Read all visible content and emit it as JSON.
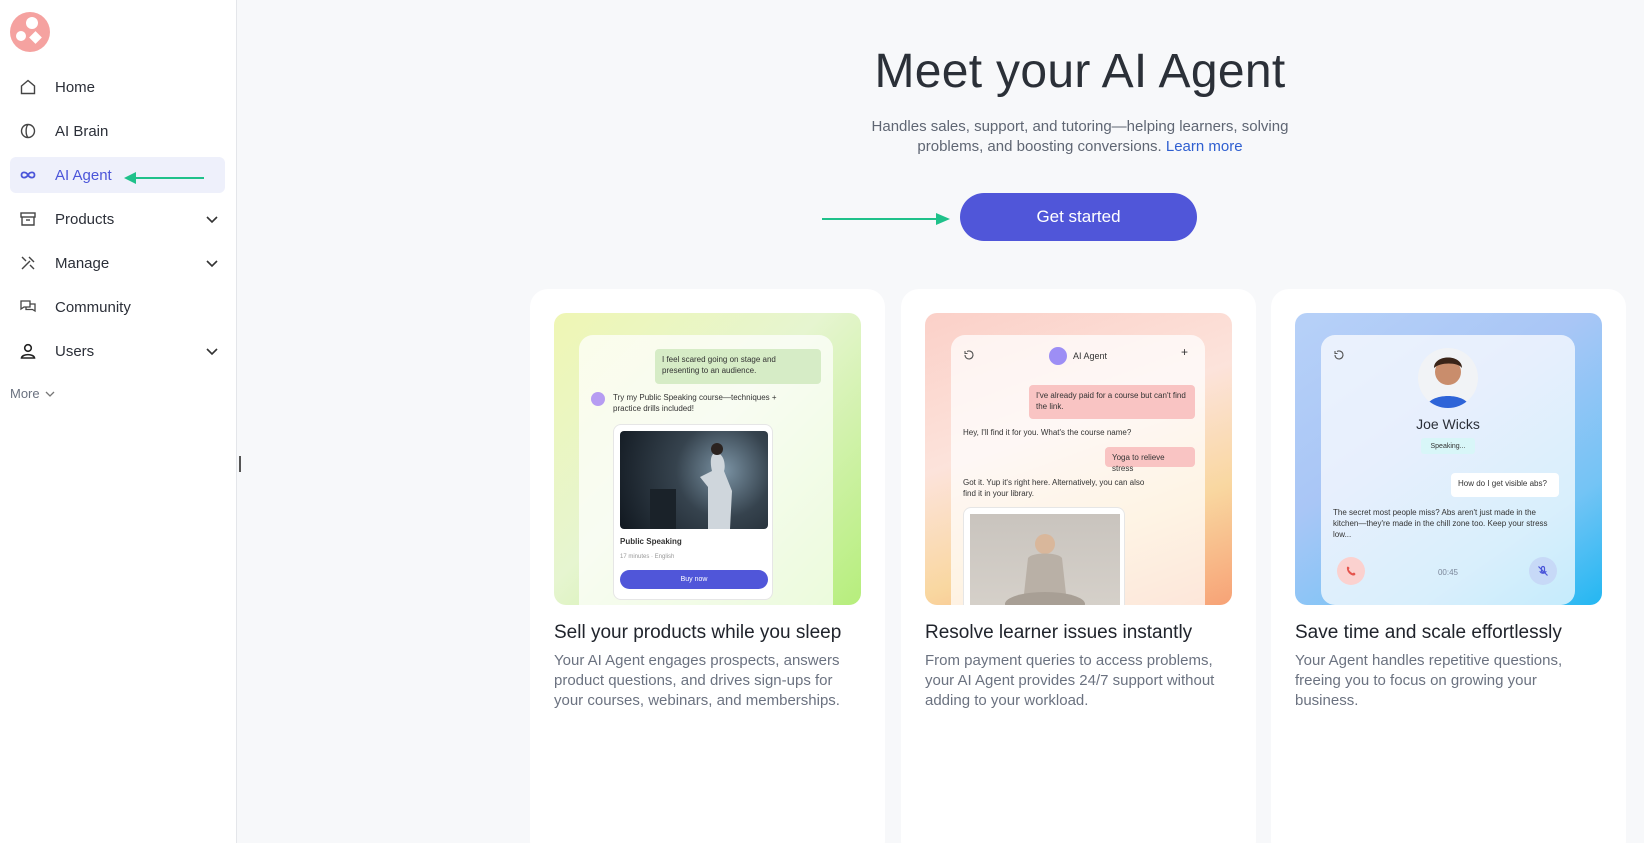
{
  "sidebar": {
    "nav": [
      {
        "label": "Home",
        "icon": "home-icon"
      },
      {
        "label": "AI Brain",
        "icon": "brain-icon"
      },
      {
        "label": "AI Agent",
        "icon": "infinity-icon",
        "active": true
      },
      {
        "label": "Products",
        "icon": "archive-icon",
        "expandable": true
      },
      {
        "label": "Manage",
        "icon": "tools-icon",
        "expandable": true
      },
      {
        "label": "Community",
        "icon": "chat-icon"
      },
      {
        "label": "Users",
        "icon": "user-icon",
        "expandable": true
      }
    ],
    "more_label": "More"
  },
  "hero": {
    "title": "Meet your AI Agent",
    "subtitle_line": "Handles sales, support, and tutoring—helping learners, solving problems, and boosting conversions.",
    "learn_more": "Learn more",
    "cta_label": "Get started"
  },
  "cards": [
    {
      "title": "Sell your products while you sleep",
      "desc": "Your AI Agent engages prospects, answers product questions, and drives sign-ups for your courses, webinars, and memberships.",
      "mock": {
        "user_msg": "I feel scared going on stage and presenting to an audience.",
        "agent_msg": "Try my Public Speaking course—techniques + practice drills included!",
        "product_name": "Public Speaking",
        "product_meta": "17 minutes · English",
        "buy_label": "Buy now"
      }
    },
    {
      "title": "Resolve learner issues instantly",
      "desc": "From payment queries to access problems, your AI Agent provides 24/7 support without adding to your workload.",
      "mock": {
        "header": "AI Agent",
        "user_msg1": "I've already paid for a course but can't find the link.",
        "agent_msg1": "Hey, I'll find it for you. What's the course name?",
        "user_msg2": "Yoga to relieve stress",
        "agent_msg2": "Got it. Yup it's right here. Alternatively, you can also find it in your library."
      }
    },
    {
      "title": "Save time and scale effortlessly",
      "desc": "Your Agent handles repetitive questions, freeing you to focus on growing your business.",
      "mock": {
        "name": "Joe Wicks",
        "status": "Speaking...",
        "user_msg": "How do I get visible abs?",
        "agent_msg": "The secret most people miss? Abs aren't just made in the kitchen—they're made in the chill zone too. Keep your stress low...",
        "timer": "00:45"
      }
    }
  ],
  "colors": {
    "accent": "#5056d9",
    "active_bg": "#eef0fb",
    "annotation_arrow": "#1fc18a"
  }
}
